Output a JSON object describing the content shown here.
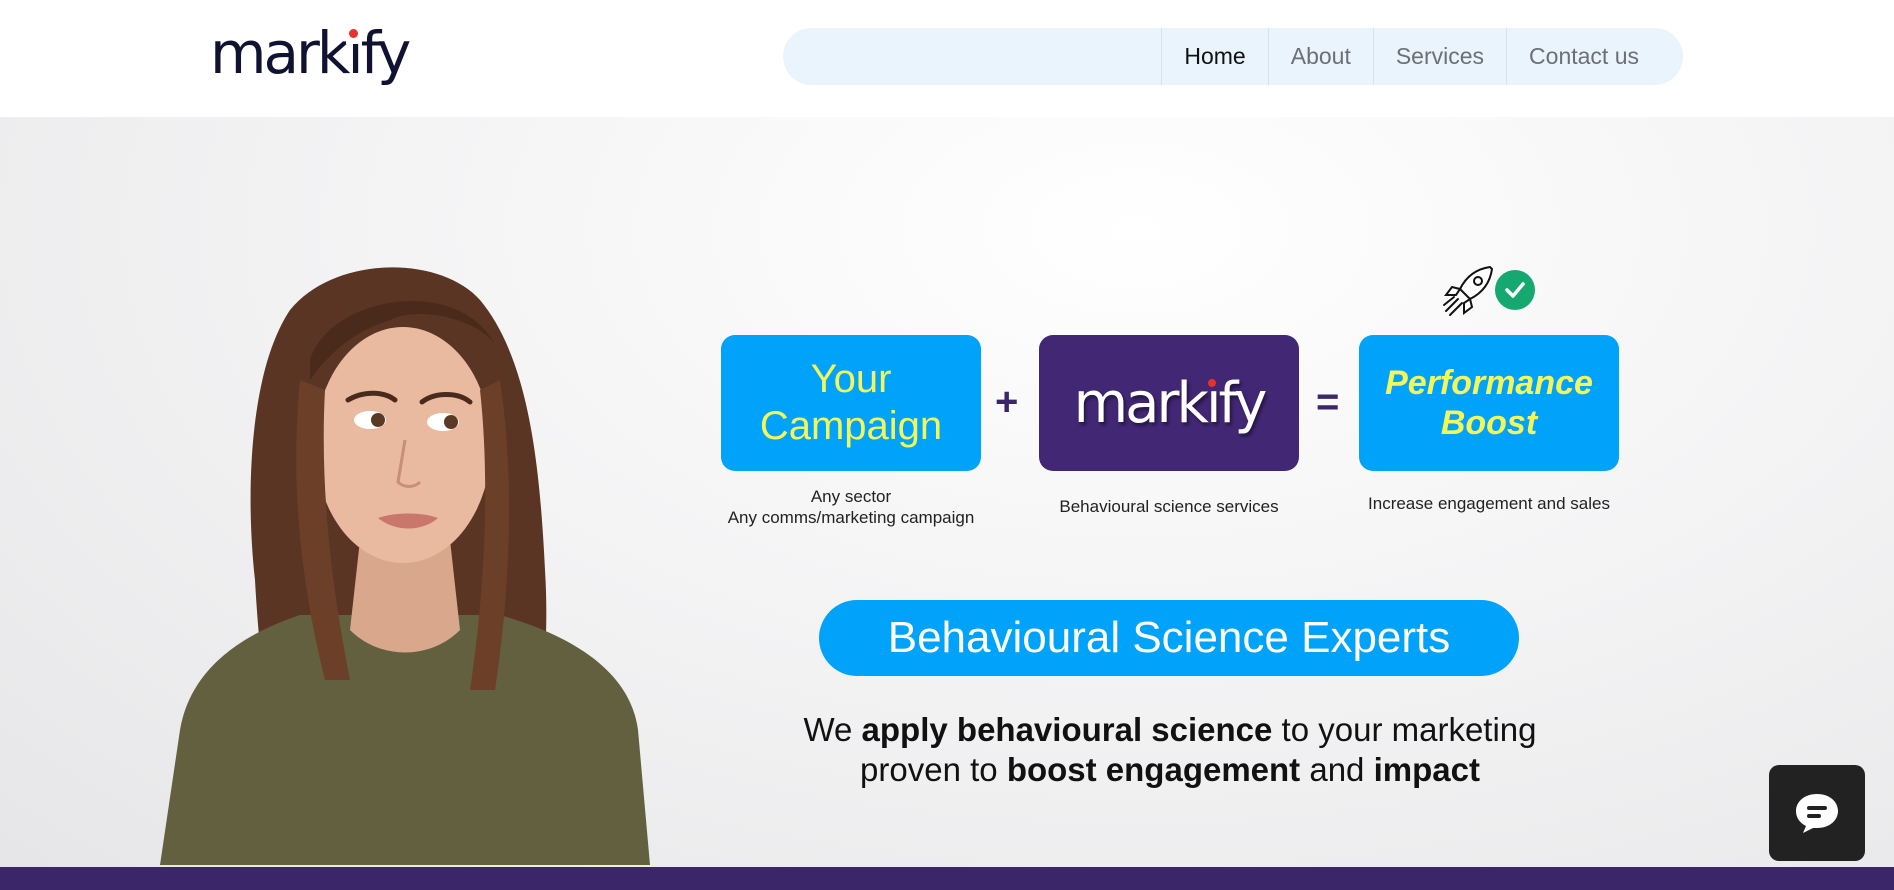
{
  "header": {
    "logo_text": {
      "pre": "mark",
      "i": "ı",
      "post": "fy"
    },
    "nav": [
      {
        "label": "Home",
        "active": true
      },
      {
        "label": "About",
        "active": false
      },
      {
        "label": "Services",
        "active": false
      },
      {
        "label": "Contact us",
        "active": false
      }
    ]
  },
  "equation": {
    "campaign": {
      "line1": "Your",
      "line2": "Campaign",
      "caption_line1": "Any sector",
      "caption_line2": "Any comms/marketing campaign"
    },
    "plus": "+",
    "markify": {
      "pre": "mark",
      "i": "ı",
      "post": "fy",
      "caption": "Behavioural science services"
    },
    "equals": "=",
    "result": {
      "line1": "Performance",
      "line2": "Boost",
      "caption": "Increase engagement and sales"
    }
  },
  "hero": {
    "pill_label": "Behavioural Science Experts",
    "tagline": {
      "p1": "We ",
      "b1": "apply behavioural science",
      "p2": " to your marketing",
      "p3": "proven to ",
      "b2": "boost engagement",
      "p4": " and ",
      "b3": "impact"
    }
  },
  "colors": {
    "brand_purple": "#422775",
    "accent_blue": "#00a2fa",
    "accent_yellow": "#f3f75a",
    "check_green": "#15a86f",
    "logo_dot_red": "#e8312a"
  },
  "icons": {
    "rocket": "rocket-icon",
    "check": "check-circle-icon",
    "chat": "chat-bubble-icon"
  }
}
